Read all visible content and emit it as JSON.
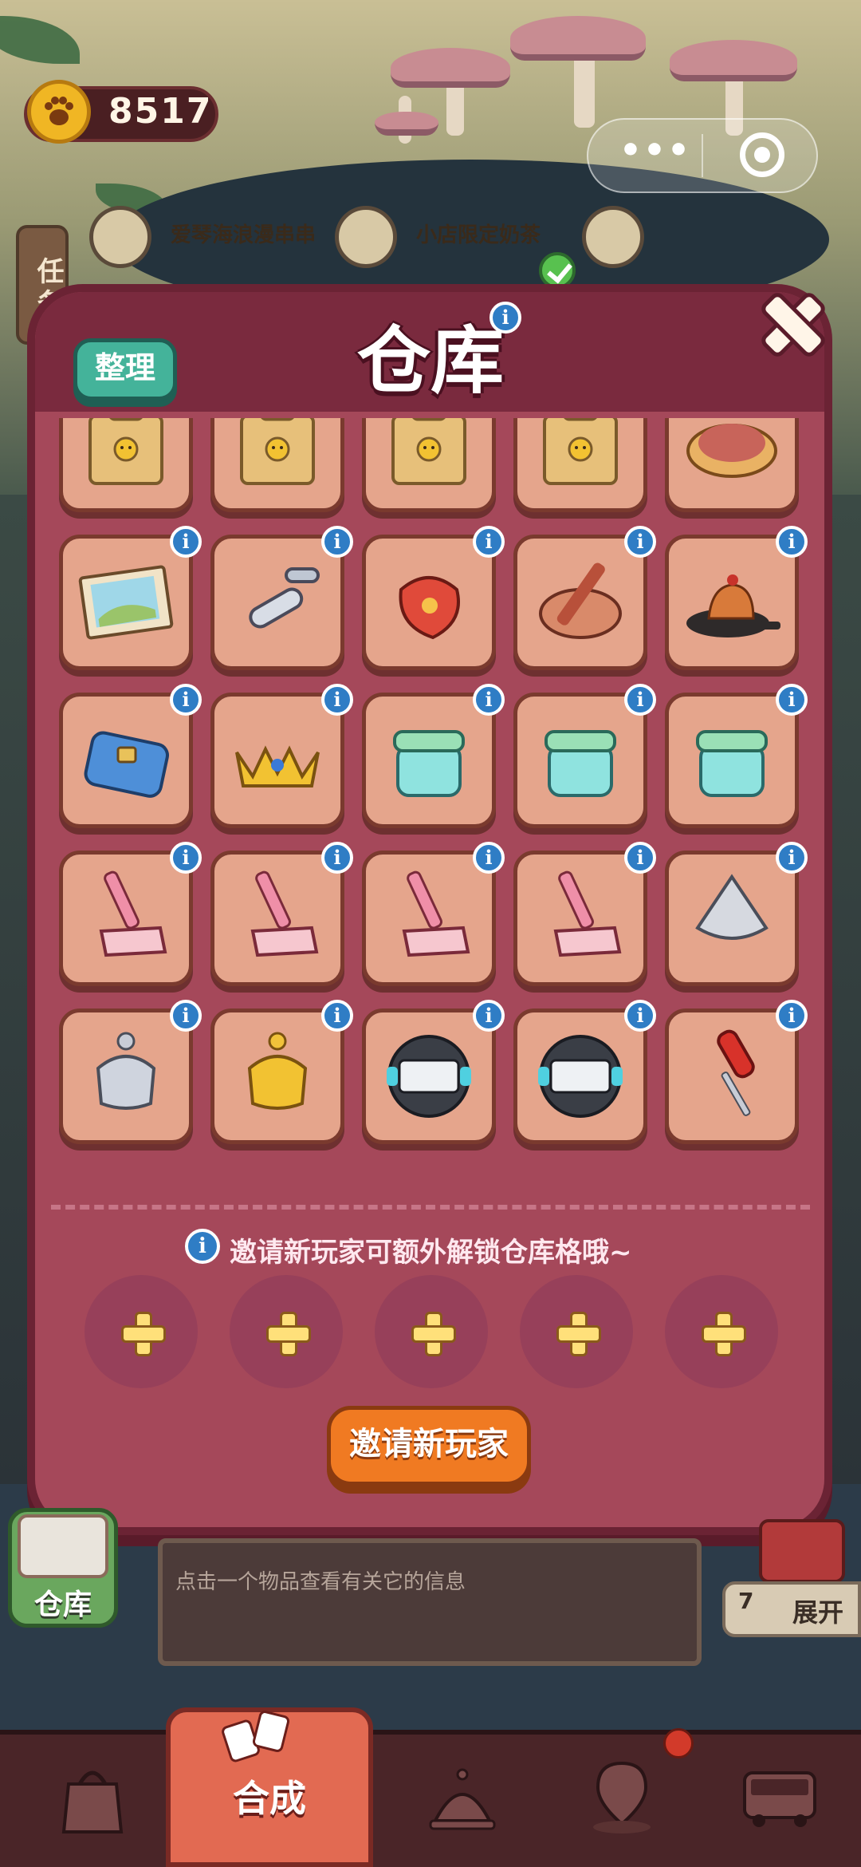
{
  "hud": {
    "coins": "8517",
    "coin_icon": "paw-coin-icon"
  },
  "capsule": {
    "more": "•••",
    "close_icon": "target-icon"
  },
  "quests": {
    "task_tab": "任务",
    "item1": "爱琴海浪漫串串",
    "item2": "小店限定奶茶"
  },
  "warehouse": {
    "title": "仓库",
    "sort_label": "整理",
    "info_glyph": "i",
    "invite_hint": "邀请新玩家可额外解锁仓库格哦~",
    "invite_button": "邀请新玩家",
    "locked_slots": 5,
    "items": [
      [
        "snack-box-icon",
        "snack-box-icon",
        "snack-box-icon",
        "snack-box-icon",
        "meat-pizza-icon"
      ],
      [
        "puzzle-picture-icon",
        "hand-crank-icon",
        "red-pouch-icon",
        "basket-icon",
        "cake-board-icon"
      ],
      [
        "blue-bag-icon",
        "gold-crown-icon",
        "teal-jar-icon",
        "teal-jar-icon",
        "teal-jar-icon"
      ],
      [
        "pink-shovel-icon",
        "pink-shovel-icon",
        "pink-shovel-icon",
        "pink-shovel-icon",
        "silver-top-icon"
      ],
      [
        "silver-lantern-icon",
        "gold-lantern-icon",
        "stopwatch-icon",
        "stopwatch-icon",
        "screwdriver-icon"
      ]
    ]
  },
  "below": {
    "info_text": "点击一个物品查看有关它的信息",
    "warehouse_label": "仓库",
    "expand_count": "7",
    "expand_label": "展开"
  },
  "nav": {
    "active_label": "合成",
    "tabs": [
      "shop-bag-icon",
      "craft-icon",
      "bell-icon",
      "map-pin-icon",
      "bus-icon"
    ]
  },
  "colors": {
    "panel": "#a5485a",
    "cell": "#e5a58c",
    "sort_button": "#44b39a",
    "invite_button": "#f07a22",
    "info_badge": "#2f7dc5"
  }
}
